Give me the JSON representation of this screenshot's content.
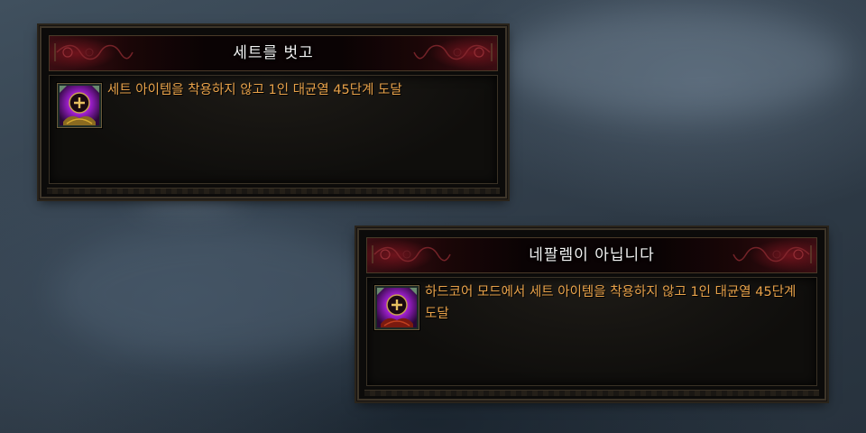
{
  "achievements": [
    {
      "title": "세트를 벗고",
      "description": "세트 아이템을 착용하지 않고 1인 대균열 45단계 도달",
      "icon": "achievement-icon"
    },
    {
      "title": "네팔렘이 아닙니다",
      "description": "하드코어 모드에서 세트 아이템을 착용하지 않고 1인 대균열 45단계 도달",
      "icon": "achievement-icon"
    }
  ],
  "colors": {
    "title_text": "#f2f2f2",
    "description_text": "#e8a24a",
    "header_red": "#3a0d12",
    "panel_border": "#3d3529",
    "icon_purple": "#b030d8"
  }
}
